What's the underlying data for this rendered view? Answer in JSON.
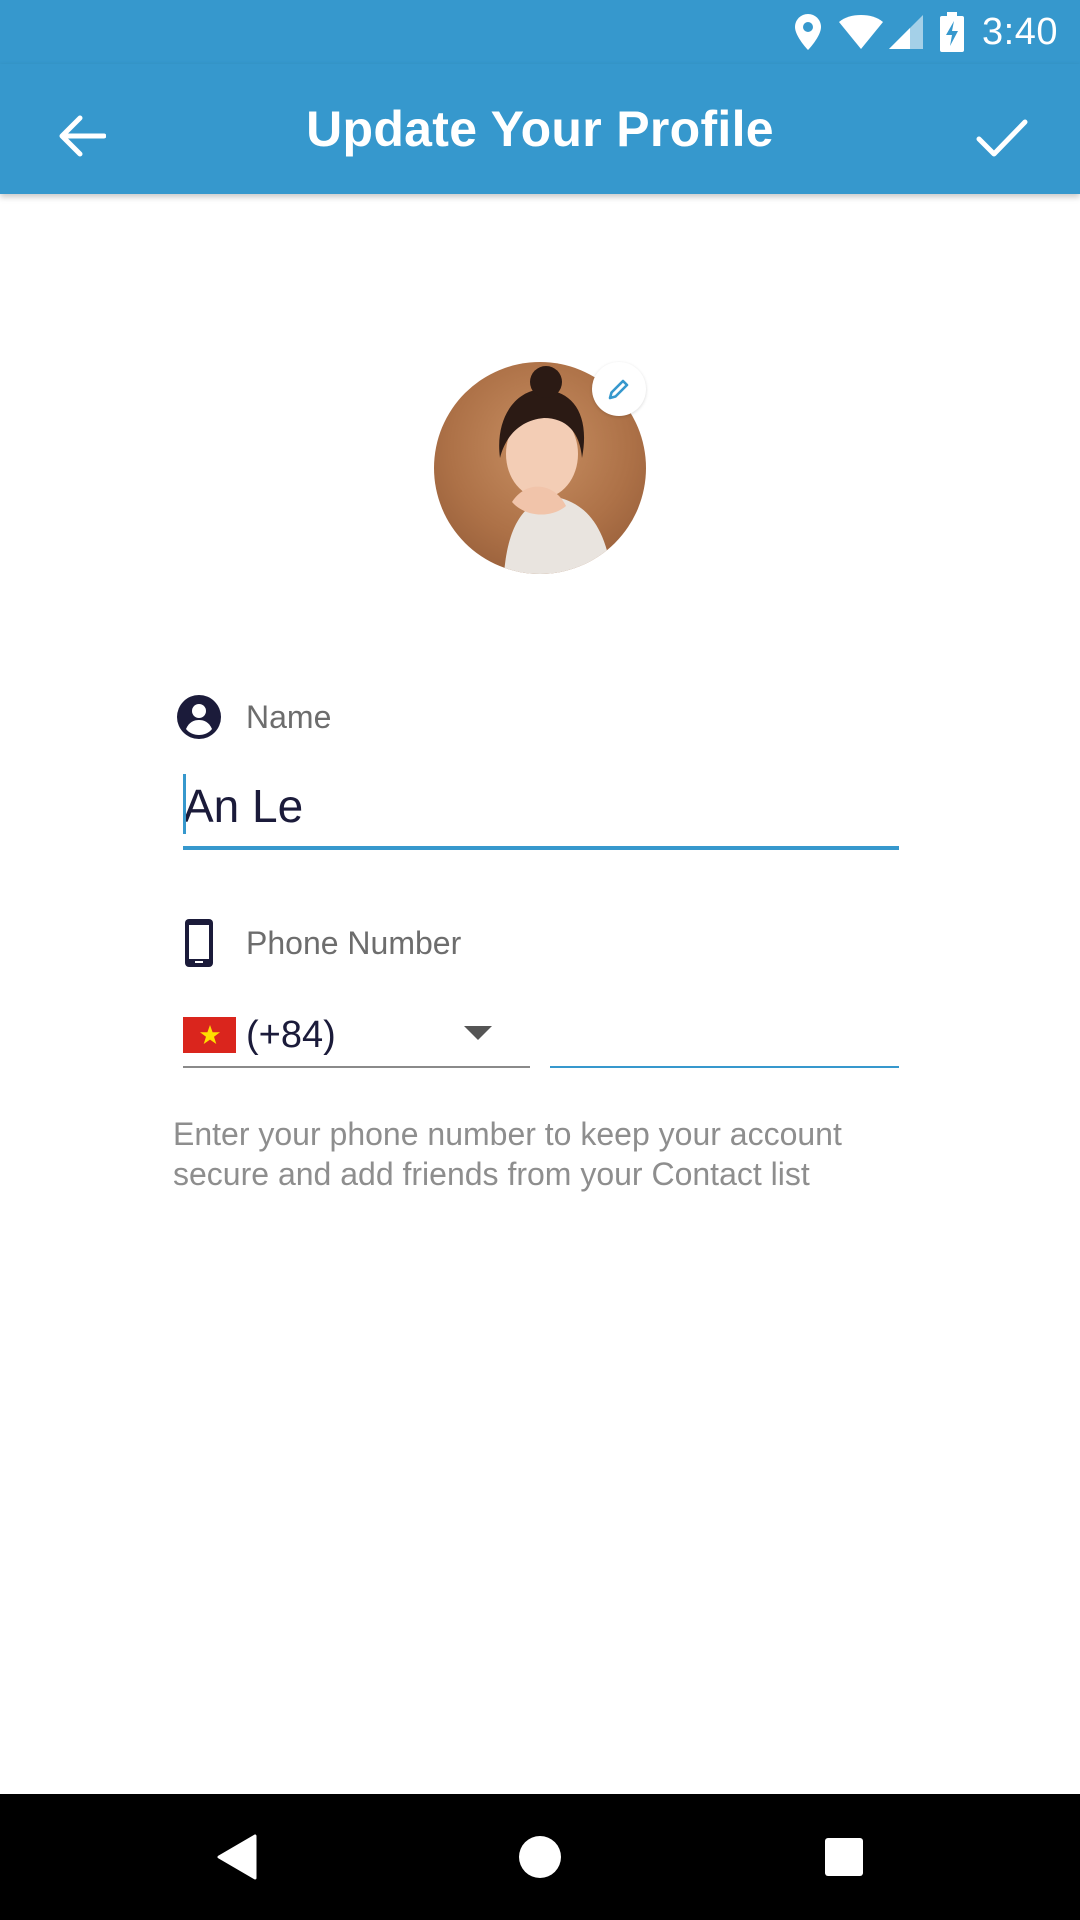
{
  "status_bar": {
    "time": "3:40",
    "icons": [
      "location-icon",
      "wifi-icon",
      "cell-signal-icon",
      "battery-charging-icon"
    ]
  },
  "app_bar": {
    "title": "Update Your Profile",
    "back_icon": "arrow-back-icon",
    "confirm_icon": "checkmark-icon",
    "background": "#3698cd"
  },
  "avatar": {
    "edit_icon": "pencil-icon"
  },
  "name_field": {
    "label": "Name",
    "icon": "account-circle-icon",
    "value": "An Le"
  },
  "phone_field": {
    "label": "Phone Number",
    "icon": "smartphone-icon",
    "country_flag": "vietnam-flag",
    "country_code": "(+84)",
    "value": ""
  },
  "helper_text": "Enter your phone number to keep your account secure and add friends from your Contact list",
  "nav_bar": {
    "icons": [
      "nav-back-icon",
      "nav-home-icon",
      "nav-recents-icon"
    ]
  },
  "colors": {
    "accent": "#3698cd",
    "text_dark": "#1b1b3a",
    "text_muted": "#8e8e8e"
  }
}
